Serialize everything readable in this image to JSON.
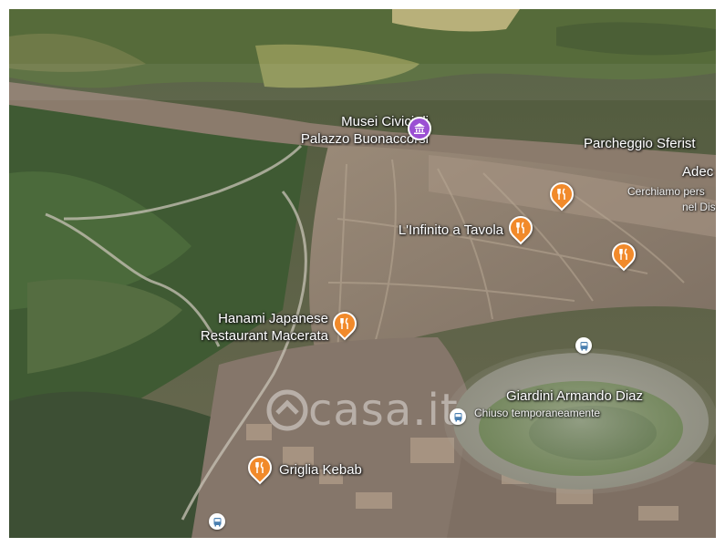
{
  "map": {
    "view": "satellite-3d",
    "colors": {
      "restaurant_pin": "#f18a2b",
      "museum_pin": "#9b4fd3",
      "bus_stop": "#4a7fb0",
      "label_text": "#ffffff"
    },
    "places": [
      {
        "id": "museum",
        "line1": "Musei Civici di",
        "line2": "Palazzo Buonaccorsi",
        "icon": "museum-icon"
      },
      {
        "id": "parking",
        "name": "Parcheggio Sferist",
        "icon": "none"
      },
      {
        "id": "adeco",
        "name": "Adec",
        "sub1": "Cerchiamo pers",
        "sub2": "nel Dis"
      },
      {
        "id": "infinito",
        "name": "L'Infinito a Tavola",
        "icon": "restaurant-icon"
      },
      {
        "id": "hanami",
        "line1": "Hanami Japanese",
        "line2": "Restaurant Macerata",
        "icon": "restaurant-icon"
      },
      {
        "id": "giardini",
        "name": "Giardini Armando Diaz",
        "sub": "Chiuso temporaneamente"
      },
      {
        "id": "kebab",
        "name": "Griglia Kebab",
        "icon": "restaurant-icon"
      }
    ],
    "unlabeled_restaurant_pins": 2,
    "bus_stops": 3,
    "watermark": "casa.it"
  }
}
